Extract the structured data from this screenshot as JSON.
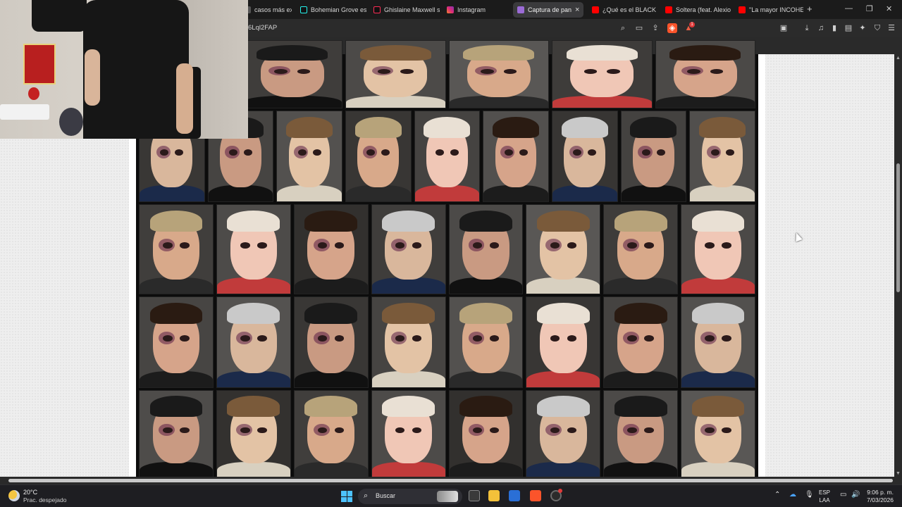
{
  "browser": {
    "tabs": [
      {
        "label": "casos más extr",
        "favicon": "generic",
        "active": false
      },
      {
        "label": "Bohemian Grove es",
        "favicon": "tiktok",
        "active": false
      },
      {
        "label": "Ghislaine Maxwell s",
        "favicon": "tiktok",
        "active": false
      },
      {
        "label": "Instagram",
        "favicon": "instagram",
        "active": false
      },
      {
        "label": "Captura de pan",
        "favicon": "pen",
        "active": true
      },
      {
        "label": "¿Qué es el BLACK E",
        "favicon": "youtube",
        "active": false
      },
      {
        "label": "Soltera (feat. Alexio",
        "favicon": "youtube",
        "active": false
      },
      {
        "label": "\"La mayor INCOHE",
        "favicon": "youtube",
        "active": false
      }
    ],
    "close_glyph": "×",
    "new_tab_glyph": "+",
    "url": "6Lql2FAP",
    "brave_badge": "1"
  },
  "page": {
    "collage_rows": 5,
    "faces": [
      {
        "skin": "#d9b79c",
        "hair": "#c9c9c9",
        "bruise": true,
        "shirt": "#1b2a4a"
      },
      {
        "skin": "#c99a82",
        "hair": "#1a1a1a",
        "bruise": true,
        "shirt": "#111111"
      },
      {
        "skin": "#e3c3a5",
        "hair": "#7a5a3a",
        "bruise": true,
        "shirt": "#d8d0c0"
      },
      {
        "skin": "#d8a98a",
        "hair": "#b7a37a",
        "bruise": true,
        "shirt": "#2a2a2a"
      },
      {
        "skin": "#f0c7b6",
        "hair": "#e9e0d4",
        "bruise": false,
        "shirt": "#c13b3b"
      },
      {
        "skin": "#d6a48a",
        "hair": "#2a1b12",
        "bruise": true,
        "shirt": "#1c1c1c"
      }
    ]
  },
  "taskbar": {
    "temperature": "20°C",
    "weather": "Prac. despejado",
    "search_label": "Buscar",
    "language_top": "ESP",
    "language_bottom": "LAA",
    "time": "9:06 p. m.",
    "date": "7/03/2026"
  }
}
